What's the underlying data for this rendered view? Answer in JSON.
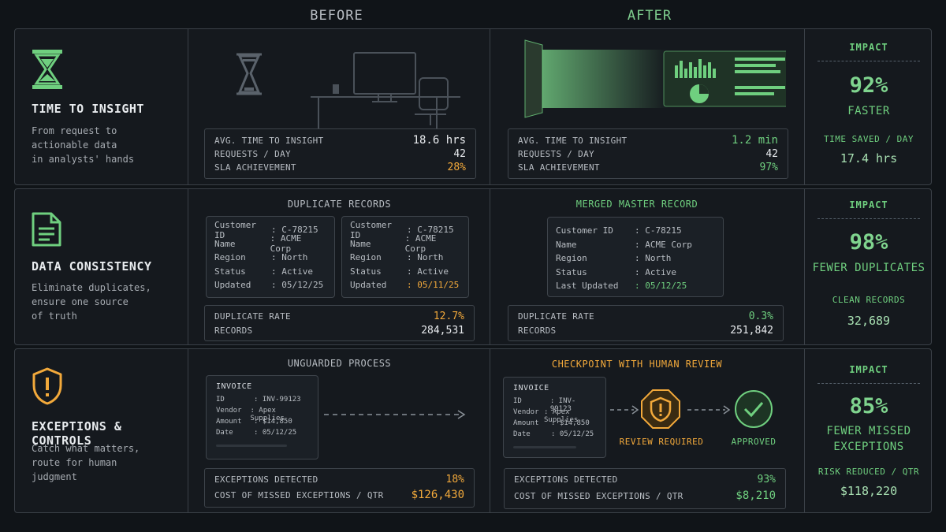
{
  "columns": {
    "before": "BEFORE",
    "after": "AFTER"
  },
  "rows": [
    {
      "title": "TIME TO INSIGHT",
      "desc": "From request to\nactionable data\nin analysts' hands",
      "before": {
        "metrics": [
          {
            "k": "AVG. TIME TO INSIGHT",
            "v": "18.6 hrs"
          },
          {
            "k": "REQUESTS / DAY",
            "v": "42"
          },
          {
            "k": "SLA ACHIEVEMENT",
            "v": "28%"
          }
        ]
      },
      "after": {
        "metrics": [
          {
            "k": "AVG. TIME TO INSIGHT",
            "v": "1.2 min"
          },
          {
            "k": "REQUESTS / DAY",
            "v": "42"
          },
          {
            "k": "SLA ACHIEVEMENT",
            "v": "97%"
          }
        ]
      },
      "impact": {
        "title": "IMPACT",
        "big": "92%",
        "sub": "FASTER",
        "small": "TIME SAVED / DAY",
        "val": "17.4 hrs"
      }
    },
    {
      "title": "DATA CONSISTENCY",
      "desc": "Eliminate duplicates,\nensure one source\nof truth",
      "before": {
        "section": "DUPLICATE RECORDS",
        "cards": [
          {
            "lines": [
              {
                "k": "Customer ID",
                "v": ": C-78215"
              },
              {
                "k": "Name",
                "v": ": ACME Corp"
              },
              {
                "k": "Region",
                "v": ": North"
              },
              {
                "k": "Status",
                "v": ": Active"
              },
              {
                "k": "Updated",
                "v": ": 05/12/25"
              }
            ]
          },
          {
            "lines": [
              {
                "k": "Customer ID",
                "v": ": C-78215"
              },
              {
                "k": "Name",
                "v": ": ACME Corp"
              },
              {
                "k": "Region",
                "v": ": North"
              },
              {
                "k": "Status",
                "v": ": Active"
              },
              {
                "k": "Updated",
                "v": ": 05/11/25"
              }
            ]
          }
        ],
        "metrics": [
          {
            "k": "DUPLICATE RATE",
            "v": "12.7%"
          },
          {
            "k": "RECORDS",
            "v": "284,531"
          }
        ]
      },
      "after": {
        "section": "MERGED MASTER RECORD",
        "card": {
          "lines": [
            {
              "k": "Customer ID",
              "v": ": C-78215"
            },
            {
              "k": "Name",
              "v": ": ACME Corp"
            },
            {
              "k": "Region",
              "v": ": North"
            },
            {
              "k": "Status",
              "v": ": Active"
            },
            {
              "k": "Last Updated",
              "v": ": 05/12/25"
            }
          ]
        },
        "metrics": [
          {
            "k": "DUPLICATE RATE",
            "v": "0.3%"
          },
          {
            "k": "RECORDS",
            "v": "251,842"
          }
        ]
      },
      "impact": {
        "title": "IMPACT",
        "big": "98%",
        "sub": "FEWER DUPLICATES",
        "small": "CLEAN RECORDS",
        "val": "32,689"
      }
    },
    {
      "title": "EXCEPTIONS & CONTROLS",
      "desc": "Catch what matters,\nroute for human\njudgment",
      "before": {
        "section": "UNGUARDED PROCESS",
        "invoice": {
          "title": "INVOICE",
          "lines": [
            {
              "k": "ID",
              "v": ": INV-99123"
            },
            {
              "k": "Vendor",
              "v": ": Apex Supplies"
            },
            {
              "k": "Amount",
              "v": ": $14,850"
            },
            {
              "k": "Date",
              "v": ": 05/12/25"
            }
          ]
        },
        "metrics": [
          {
            "k": "EXCEPTIONS DETECTED",
            "v": "18%"
          },
          {
            "k": "COST OF MISSED EXCEPTIONS / QTR",
            "v": "$126,430"
          }
        ]
      },
      "after": {
        "section": "CHECKPOINT WITH HUMAN REVIEW",
        "invoice": {
          "title": "INVOICE",
          "lines": [
            {
              "k": "ID",
              "v": ": INV-99123"
            },
            {
              "k": "Vendor",
              "v": ": Apex Supplies"
            },
            {
              "k": "Amount",
              "v": ": $14,850"
            },
            {
              "k": "Date",
              "v": ": 05/12/25"
            }
          ]
        },
        "review_label": "REVIEW REQUIRED",
        "approved_label": "APPROVED",
        "metrics": [
          {
            "k": "EXCEPTIONS DETECTED",
            "v": "93%"
          },
          {
            "k": "COST OF MISSED EXCEPTIONS / QTR",
            "v": "$8,210"
          }
        ]
      },
      "impact": {
        "title": "IMPACT",
        "big": "85%",
        "sub": "FEWER MISSED\nEXCEPTIONS",
        "small": "RISK REDUCED / QTR",
        "val": "$118,220"
      }
    }
  ],
  "colors": {
    "accent_green": "#6fcf7f",
    "accent_orange": "#f2a93b",
    "background": "#101418",
    "border": "#3a4047"
  },
  "icons": [
    "hourglass-icon",
    "document-icon",
    "shield-alert-icon",
    "desk-computer-illustration",
    "dashboard-illustration",
    "review-octagon-icon",
    "approved-check-icon"
  ]
}
